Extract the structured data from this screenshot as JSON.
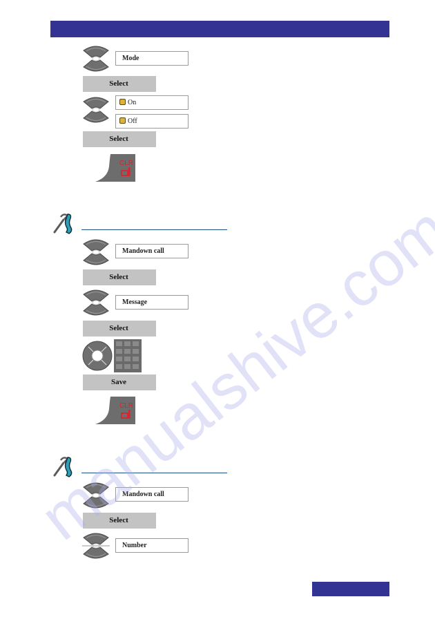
{
  "watermark": "manualshive.com",
  "colors": {
    "header_bar": "#333394",
    "softkey_bg": "#c3c3c3",
    "section_rule": "#1f4f84",
    "clr_text": "#e0202a",
    "led": "#e0b23a"
  },
  "section1": {
    "steps": [
      {
        "type": "nav-updown",
        "field": "Mode"
      },
      {
        "type": "softkey",
        "label": "Select"
      },
      {
        "type": "nav-updown",
        "options": [
          {
            "label": "On",
            "icon": "radio-led-icon"
          },
          {
            "label": "Off",
            "icon": "radio-led-icon"
          }
        ]
      },
      {
        "type": "softkey",
        "label": "Select"
      },
      {
        "type": "clr-key",
        "label": "CLR"
      }
    ]
  },
  "section2": {
    "icon": "settings-tool-phone-icon",
    "steps": [
      {
        "type": "nav-updown",
        "field": "Mandown call"
      },
      {
        "type": "softkey",
        "label": "Select"
      },
      {
        "type": "nav-updown",
        "field": "Message"
      },
      {
        "type": "softkey",
        "label": "Select"
      },
      {
        "type": "nav-keypad"
      },
      {
        "type": "softkey",
        "label": "Save"
      },
      {
        "type": "clr-key",
        "label": "CLR"
      }
    ]
  },
  "section3": {
    "icon": "settings-tool-phone-icon",
    "steps": [
      {
        "type": "nav-updown",
        "field": "Mandown call"
      },
      {
        "type": "softkey",
        "label": "Select"
      },
      {
        "type": "nav-updown",
        "field": "Number"
      }
    ]
  }
}
